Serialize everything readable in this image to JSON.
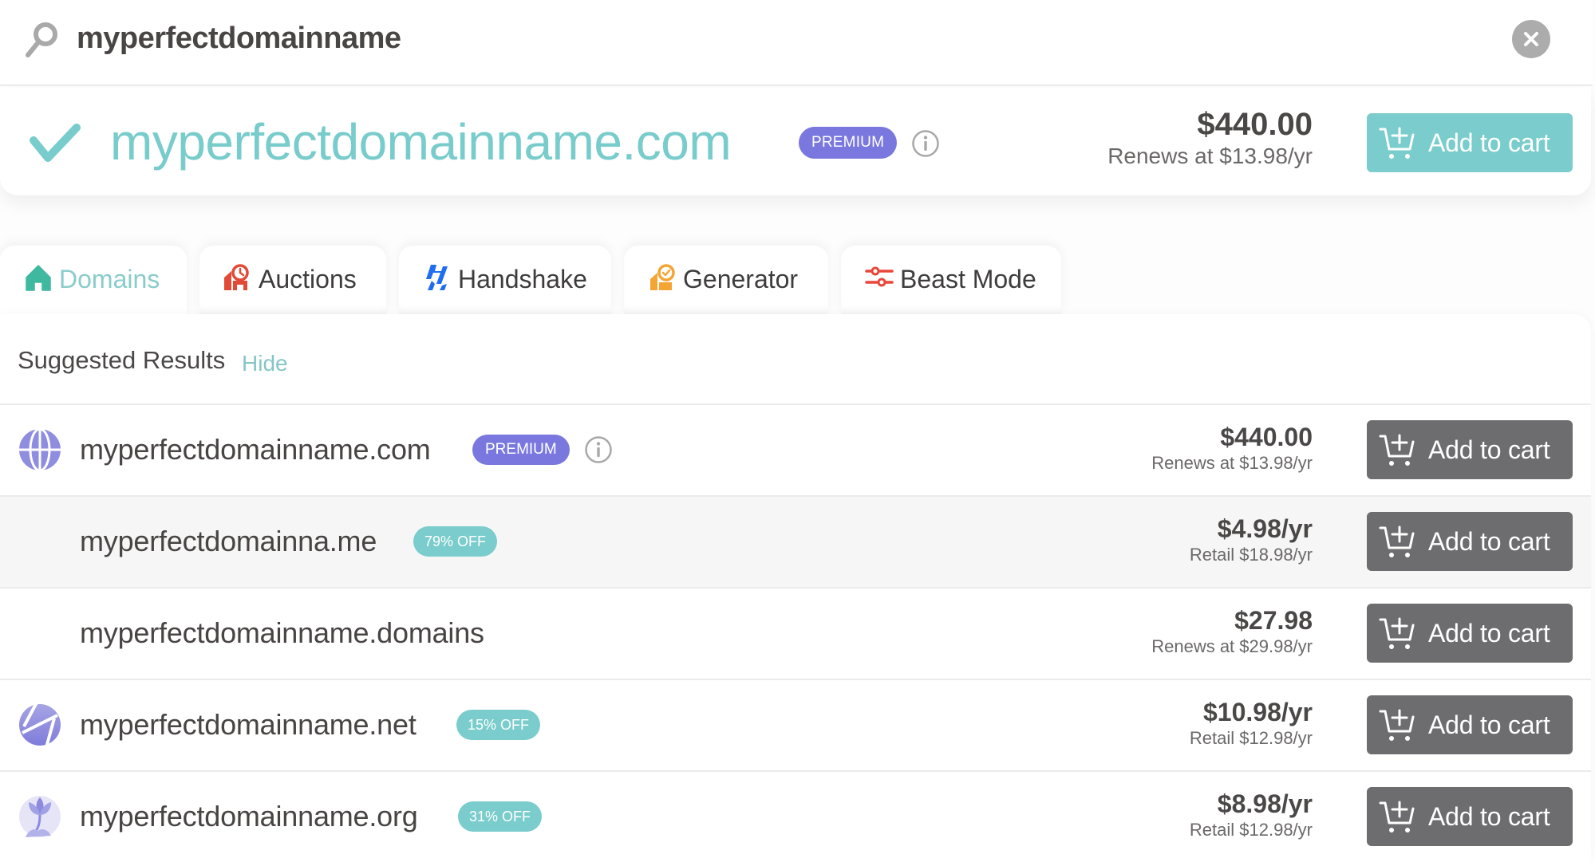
{
  "search": {
    "query": "myperfectdomainname",
    "clear_label": "Clear search"
  },
  "featured": {
    "domain": "myperfectdomainname.com",
    "badge": "PREMIUM",
    "price": "$440.00",
    "renewal": "Renews at $13.98/yr",
    "cart_label": "Add to cart",
    "status": "available",
    "accent_color": "#78cccb"
  },
  "tabs": [
    {
      "label": "Domains",
      "icon": "house-icon",
      "active": true
    },
    {
      "label": "Auctions",
      "icon": "auction-house-icon",
      "active": false
    },
    {
      "label": "Handshake",
      "icon": "handshake-icon",
      "active": false
    },
    {
      "label": "Generator",
      "icon": "generator-icon",
      "active": false
    },
    {
      "label": "Beast Mode",
      "icon": "sliders-icon",
      "active": false
    }
  ],
  "results": {
    "title": "Suggested Results",
    "hide_label": "Hide",
    "rows": [
      {
        "domain": "myperfectdomainname.com",
        "badge": "PREMIUM",
        "badge_type": "premium",
        "icon": "globe-icon",
        "price": "$440.00",
        "sub": "Renews at $13.98/yr",
        "cart_label": "Add to cart"
      },
      {
        "domain": "myperfectdomainna.me",
        "badge": "79% OFF",
        "badge_type": "off",
        "icon": "",
        "price": "$4.98/yr",
        "sub": "Retail $18.98/yr",
        "cart_label": "Add to cart"
      },
      {
        "domain": "myperfectdomainname.domains",
        "badge": "",
        "badge_type": "",
        "icon": "",
        "price": "$27.98",
        "sub": "Renews at $29.98/yr",
        "cart_label": "Add to cart"
      },
      {
        "domain": "myperfectdomainname.net",
        "badge": "15% OFF",
        "badge_type": "off",
        "icon": "net-globe-icon",
        "price": "$10.98/yr",
        "sub": "Retail $12.98/yr",
        "cart_label": "Add to cart"
      },
      {
        "domain": "myperfectdomainname.org",
        "badge": "31% OFF",
        "badge_type": "off",
        "icon": "org-flower-icon",
        "price": "$8.98/yr",
        "sub": "Retail $12.98/yr",
        "cart_label": "Add to cart"
      }
    ]
  },
  "colors": {
    "teal": "#7acdcc",
    "premium_purple": "#7a78de",
    "cart_dark": "#6d6d6f",
    "text_dark": "#4a4747"
  }
}
